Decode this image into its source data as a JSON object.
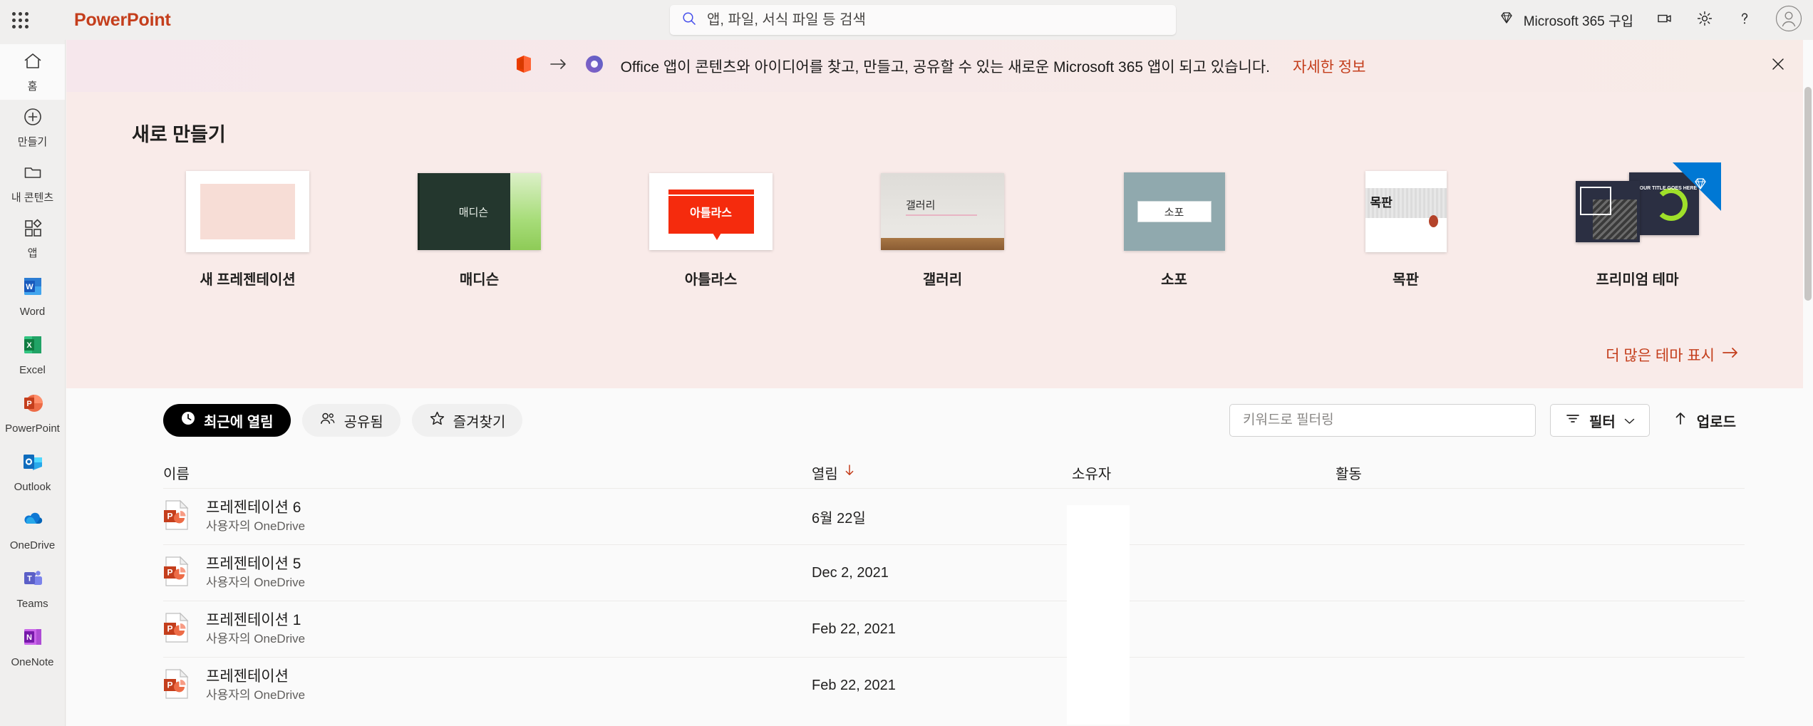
{
  "topbar": {
    "waffle_label": "app-launcher",
    "brand": "PowerPoint",
    "search_placeholder": "앱, 파일, 서식 파일 등 검색",
    "search_value": "",
    "buy_label": "Microsoft 365 구입",
    "icons": [
      "diamond-icon",
      "video-icon",
      "gear-icon",
      "help-icon",
      "account-icon"
    ]
  },
  "sidebar": {
    "nav": [
      {
        "label": "홈",
        "icon": "home-icon",
        "active": true
      },
      {
        "label": "만들기",
        "icon": "plus-circle-icon",
        "active": false
      },
      {
        "label": "내 콘텐츠",
        "icon": "folder-icon",
        "active": false
      },
      {
        "label": "앱",
        "icon": "apps-icon",
        "active": false
      }
    ],
    "apps": [
      {
        "label": "Word",
        "color": "#185abd"
      },
      {
        "label": "Excel",
        "color": "#107c41"
      },
      {
        "label": "PowerPoint",
        "color": "#c43e1c"
      },
      {
        "label": "Outlook",
        "color": "#0f6cbd"
      },
      {
        "label": "OneDrive",
        "color": "#0364b8"
      },
      {
        "label": "Teams",
        "color": "#5b5fc7"
      },
      {
        "label": "OneNote",
        "color": "#7719aa"
      }
    ]
  },
  "promo": {
    "text": "Office 앱이 콘텐츠와 아이디어를 찾고, 만들고, 공유할 수 있는 새로운 Microsoft 365 앱이 되고 있습니다.",
    "link": "자세한 정보",
    "close_label": "닫기"
  },
  "hero": {
    "title": "새로 만들기",
    "show_more": "더 많은 테마 표시",
    "templates": [
      {
        "label": "새 프레젠테이션",
        "thumb": "blank",
        "premium": false
      },
      {
        "label": "매디슨",
        "thumb": "madison",
        "thumb_text": "매디슨",
        "premium": false
      },
      {
        "label": "아틀라스",
        "thumb": "atlas",
        "thumb_text": "아틀라스",
        "premium": false
      },
      {
        "label": "갤러리",
        "thumb": "gallery",
        "thumb_text": "갤러리",
        "premium": false
      },
      {
        "label": "소포",
        "thumb": "parcel",
        "thumb_text": "소포",
        "premium": false
      },
      {
        "label": "목판",
        "thumb": "woodtype",
        "thumb_text": "목판",
        "premium": false
      },
      {
        "label": "프리미엄 테마",
        "thumb": "premium",
        "thumb_text": "YOUR TITLE GOES HERE",
        "premium": true
      }
    ]
  },
  "filters": {
    "pills": [
      {
        "label": "최근에 열림",
        "icon": "clock-icon",
        "active": true
      },
      {
        "label": "공유됨",
        "icon": "people-icon",
        "active": false
      },
      {
        "label": "즐겨찾기",
        "icon": "star-icon",
        "active": false
      }
    ],
    "keyword_placeholder": "키워드로 필터링",
    "keyword_value": "",
    "filter_label": "필터",
    "upload_label": "업로드"
  },
  "filelist": {
    "columns": {
      "name": "이름",
      "opened": "열림",
      "owner": "소유자",
      "activity": "활동"
    },
    "sort_direction": "desc",
    "rows": [
      {
        "name": "프레젠테이션 6",
        "location": "사용자의 OneDrive",
        "opened": "6월 22일",
        "owner": "",
        "activity": ""
      },
      {
        "name": "프레젠테이션 5",
        "location": "사용자의 OneDrive",
        "opened": "Dec 2, 2021",
        "owner": "",
        "activity": ""
      },
      {
        "name": "프레젠테이션 1",
        "location": "사용자의 OneDrive",
        "opened": "Feb 22, 2021",
        "owner": "",
        "activity": ""
      },
      {
        "name": "프레젠테이션",
        "location": "사용자의 OneDrive",
        "opened": "Feb 22, 2021",
        "owner": "",
        "activity": ""
      }
    ]
  },
  "colors": {
    "brand": "#c43e1c",
    "hero_bg": "#f9ebe9",
    "accent_blue": "#0078d4",
    "topbar_bg": "#f0efee"
  }
}
